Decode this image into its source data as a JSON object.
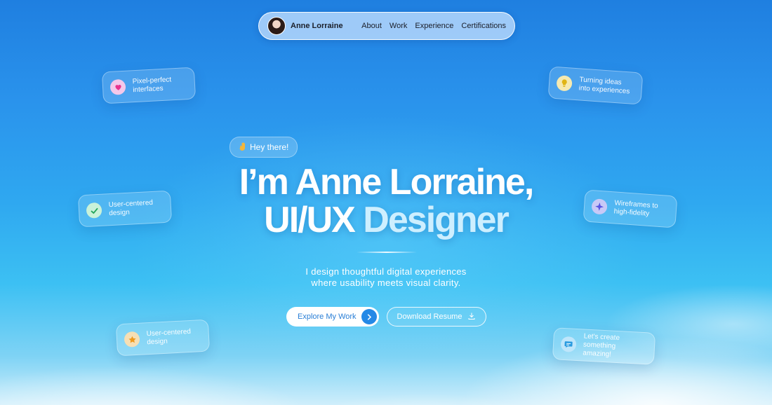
{
  "nav": {
    "name": "Anne Lorraine",
    "links": [
      "About",
      "Work",
      "Experience",
      "Certifications"
    ]
  },
  "chips": [
    {
      "text": "Pixel-perfect interfaces",
      "icon": "heart-icon"
    },
    {
      "text": "Turning ideas into experiences",
      "icon": "lightbulb-icon"
    },
    {
      "text": "User-centered design",
      "icon": "check-icon"
    },
    {
      "text": "Wireframes to high-fidelity",
      "icon": "sparkle-icon"
    },
    {
      "text": "User-centered design",
      "icon": "star-icon"
    },
    {
      "text": "Let's create something amazing!",
      "icon": "chat-icon"
    }
  ],
  "hero": {
    "greeting": "Hey there!",
    "title_line1": "I’m Anne Lorraine,",
    "title_line2_a": "UI/UX",
    "title_line2_b": "Designer",
    "subtitle_line1": "I design thoughtful digital experiences",
    "subtitle_line2": "where usability meets visual clarity."
  },
  "actions": {
    "primary": "Explore My Work",
    "secondary": "Download Resume"
  },
  "colors": {
    "accent": "#2589e6",
    "sky_top": "#1f7fe0",
    "sky_bottom": "#cfeefb"
  }
}
